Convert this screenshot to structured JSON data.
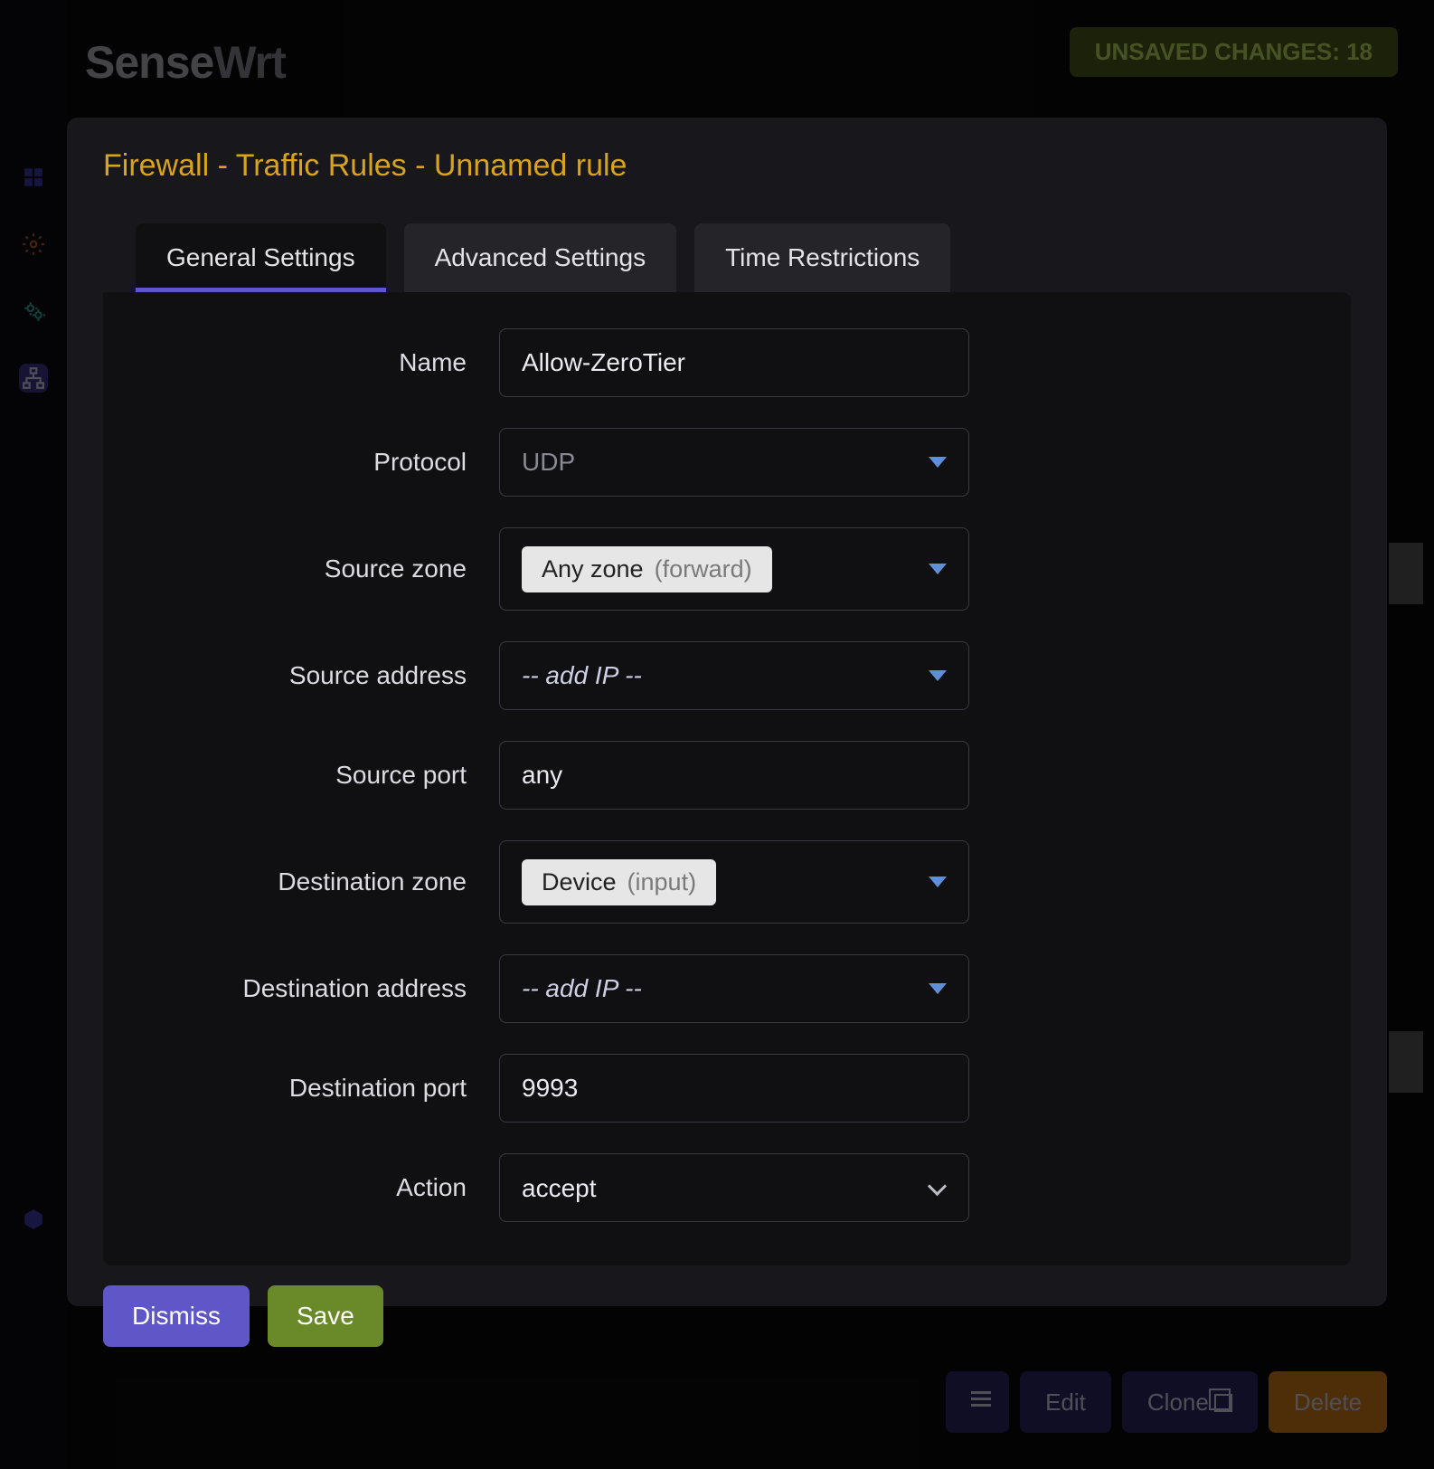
{
  "brand": {
    "bold": "Sense",
    "light": "Wrt"
  },
  "header": {
    "unsaved_label": "UNSAVED CHANGES: 18"
  },
  "row_actions": {
    "edit": "Edit",
    "clone": "Clone",
    "delete": "Delete"
  },
  "modal": {
    "title": "Firewall - Traffic Rules - Unnamed rule",
    "tabs": {
      "general": "General Settings",
      "advanced": "Advanced Settings",
      "time": "Time Restrictions"
    },
    "fields": {
      "name_label": "Name",
      "name_value": "Allow-ZeroTier",
      "protocol_label": "Protocol",
      "protocol_value": "UDP",
      "src_zone_label": "Source zone",
      "src_zone_chip": "Any zone",
      "src_zone_hint": "(forward)",
      "src_addr_label": "Source address",
      "src_addr_placeholder": "-- add IP --",
      "src_port_label": "Source port",
      "src_port_value": "any",
      "dst_zone_label": "Destination zone",
      "dst_zone_chip": "Device",
      "dst_zone_hint": "(input)",
      "dst_addr_label": "Destination address",
      "dst_addr_placeholder": "-- add IP --",
      "dst_port_label": "Destination port",
      "dst_port_value": "9993",
      "action_label": "Action",
      "action_value": "accept"
    },
    "footer": {
      "dismiss": "Dismiss",
      "save": "Save"
    }
  }
}
